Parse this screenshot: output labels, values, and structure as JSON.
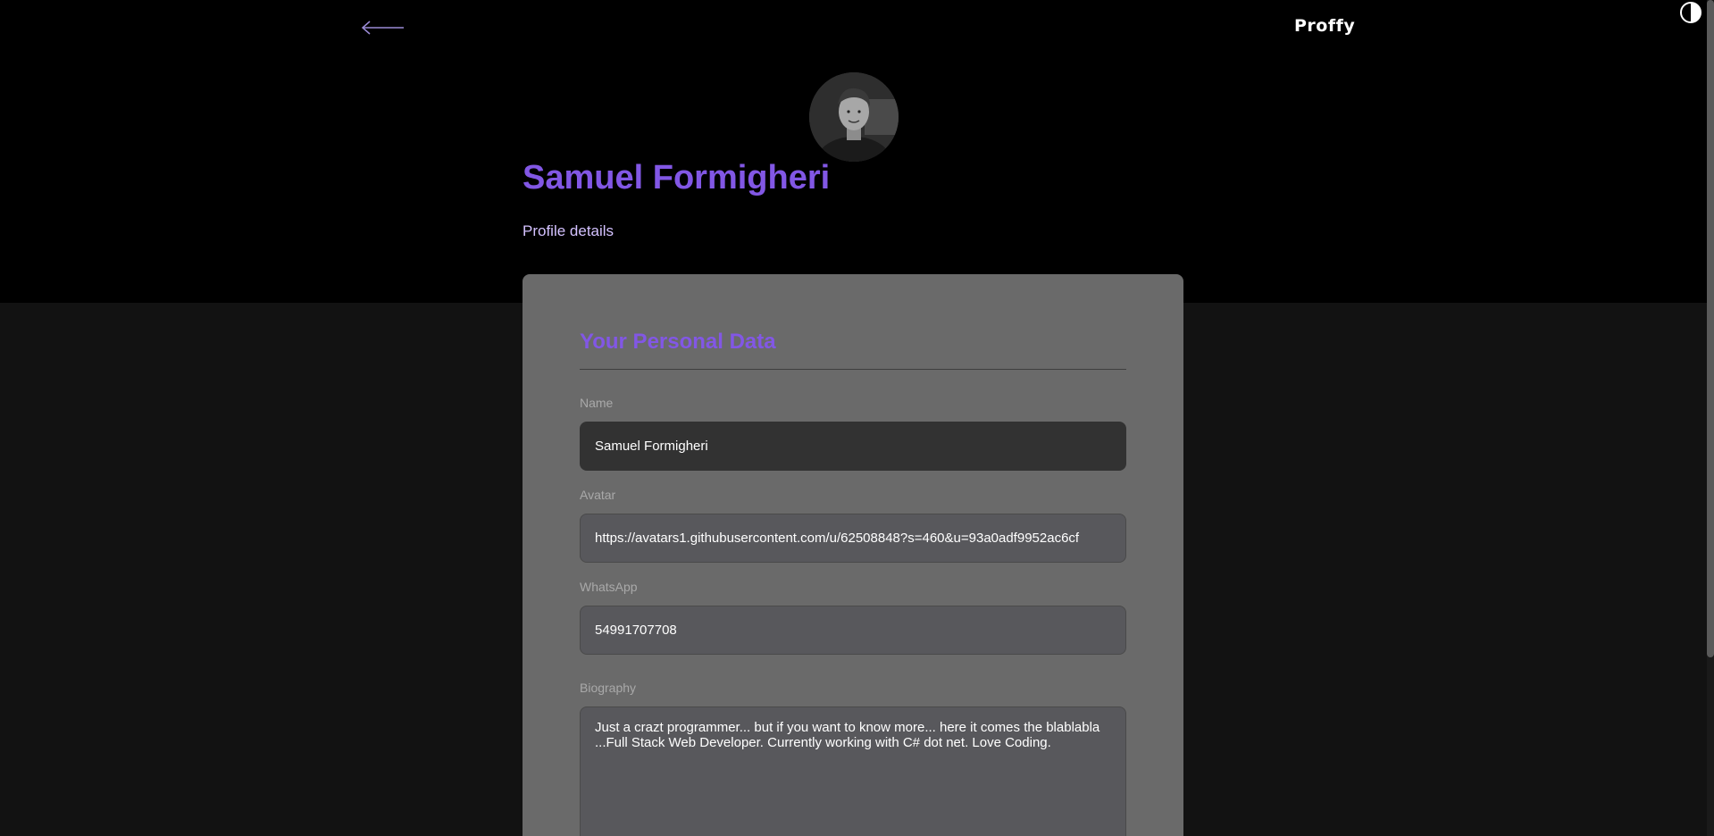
{
  "header": {
    "back_icon": "arrow-left-icon",
    "brand": "Proffy",
    "theme_icon": "contrast-icon"
  },
  "profile": {
    "name": "Samuel Formigheri",
    "subtitle": "Profile details"
  },
  "form": {
    "legend": "Your Personal Data",
    "name_label": "Name",
    "name_value": "Samuel Formigheri",
    "avatar_label": "Avatar",
    "avatar_value": "https://avatars1.githubusercontent.com/u/62508848?s=460&u=93a0adf9952ac6cf",
    "whatsapp_label": "WhatsApp",
    "whatsapp_value": "54991707708",
    "bio_label": "Biography",
    "bio_value": "Just a crazt programmer... but if you want to know more... here it comes the blablabla ...Full Stack Web Developer. Currently working with C# dot net. Love Coding."
  },
  "colors": {
    "accent": "#8257e5",
    "header_bg": "#000000",
    "page_bg": "#121212",
    "card_bg": "#6a6a6a"
  }
}
